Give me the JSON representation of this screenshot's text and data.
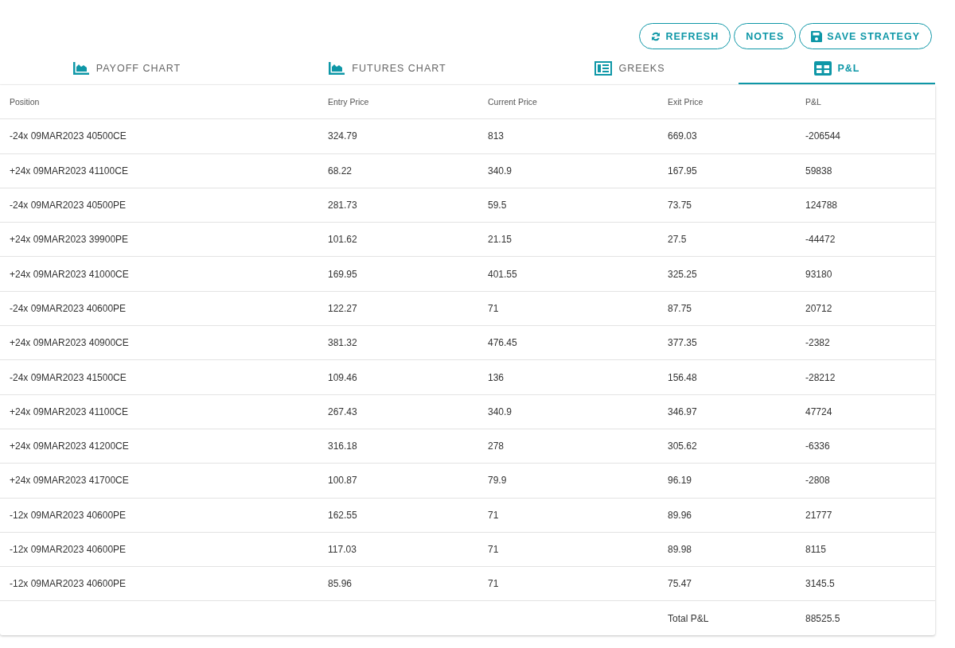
{
  "actions": [
    {
      "kind": "refresh",
      "label": "REFRESH"
    },
    {
      "kind": "plain",
      "label": "NOTES"
    },
    {
      "kind": "save",
      "label": "SAVE STRATEGY"
    }
  ],
  "tabs": [
    {
      "kind": "area",
      "label": "PAYOFF CHART",
      "selected": false
    },
    {
      "kind": "area",
      "label": "FUTURES CHART",
      "selected": false
    },
    {
      "kind": "list",
      "label": "GREEKS",
      "selected": false
    },
    {
      "kind": "grid",
      "label": "P&L",
      "selected": true
    }
  ],
  "table": {
    "columns": [
      "Position",
      "Entry Price",
      "Current Price",
      "Exit Price",
      "P&L"
    ],
    "rows": [
      [
        "-24x 09MAR2023 40500CE",
        "324.79",
        "813",
        "669.03",
        "-206544"
      ],
      [
        "+24x 09MAR2023 41100CE",
        "68.22",
        "340.9",
        "167.95",
        "59838"
      ],
      [
        "-24x 09MAR2023 40500PE",
        "281.73",
        "59.5",
        "73.75",
        "124788"
      ],
      [
        "+24x 09MAR2023 39900PE",
        "101.62",
        "21.15",
        "27.5",
        "-44472"
      ],
      [
        "+24x 09MAR2023 41000CE",
        "169.95",
        "401.55",
        "325.25",
        "93180"
      ],
      [
        "-24x 09MAR2023 40600PE",
        "122.27",
        "71",
        "87.75",
        "20712"
      ],
      [
        "+24x 09MAR2023 40900CE",
        "381.32",
        "476.45",
        "377.35",
        "-2382"
      ],
      [
        "-24x 09MAR2023 41500CE",
        "109.46",
        "136",
        "156.48",
        "-28212"
      ],
      [
        "+24x 09MAR2023 41100CE",
        "267.43",
        "340.9",
        "346.97",
        "47724"
      ],
      [
        "+24x 09MAR2023 41200CE",
        "316.18",
        "278",
        "305.62",
        "-6336"
      ],
      [
        "+24x 09MAR2023 41700CE",
        "100.87",
        "79.9",
        "96.19",
        "-2808"
      ],
      [
        "-12x 09MAR2023 40600PE",
        "162.55",
        "71",
        "89.96",
        "21777"
      ],
      [
        "-12x 09MAR2023 40600PE",
        "117.03",
        "71",
        "89.98",
        "8115"
      ],
      [
        "-12x 09MAR2023 40600PE",
        "85.96",
        "71",
        "75.47",
        "3145.5"
      ]
    ],
    "total": {
      "label": "Total P&L",
      "value": "88525.5"
    }
  }
}
